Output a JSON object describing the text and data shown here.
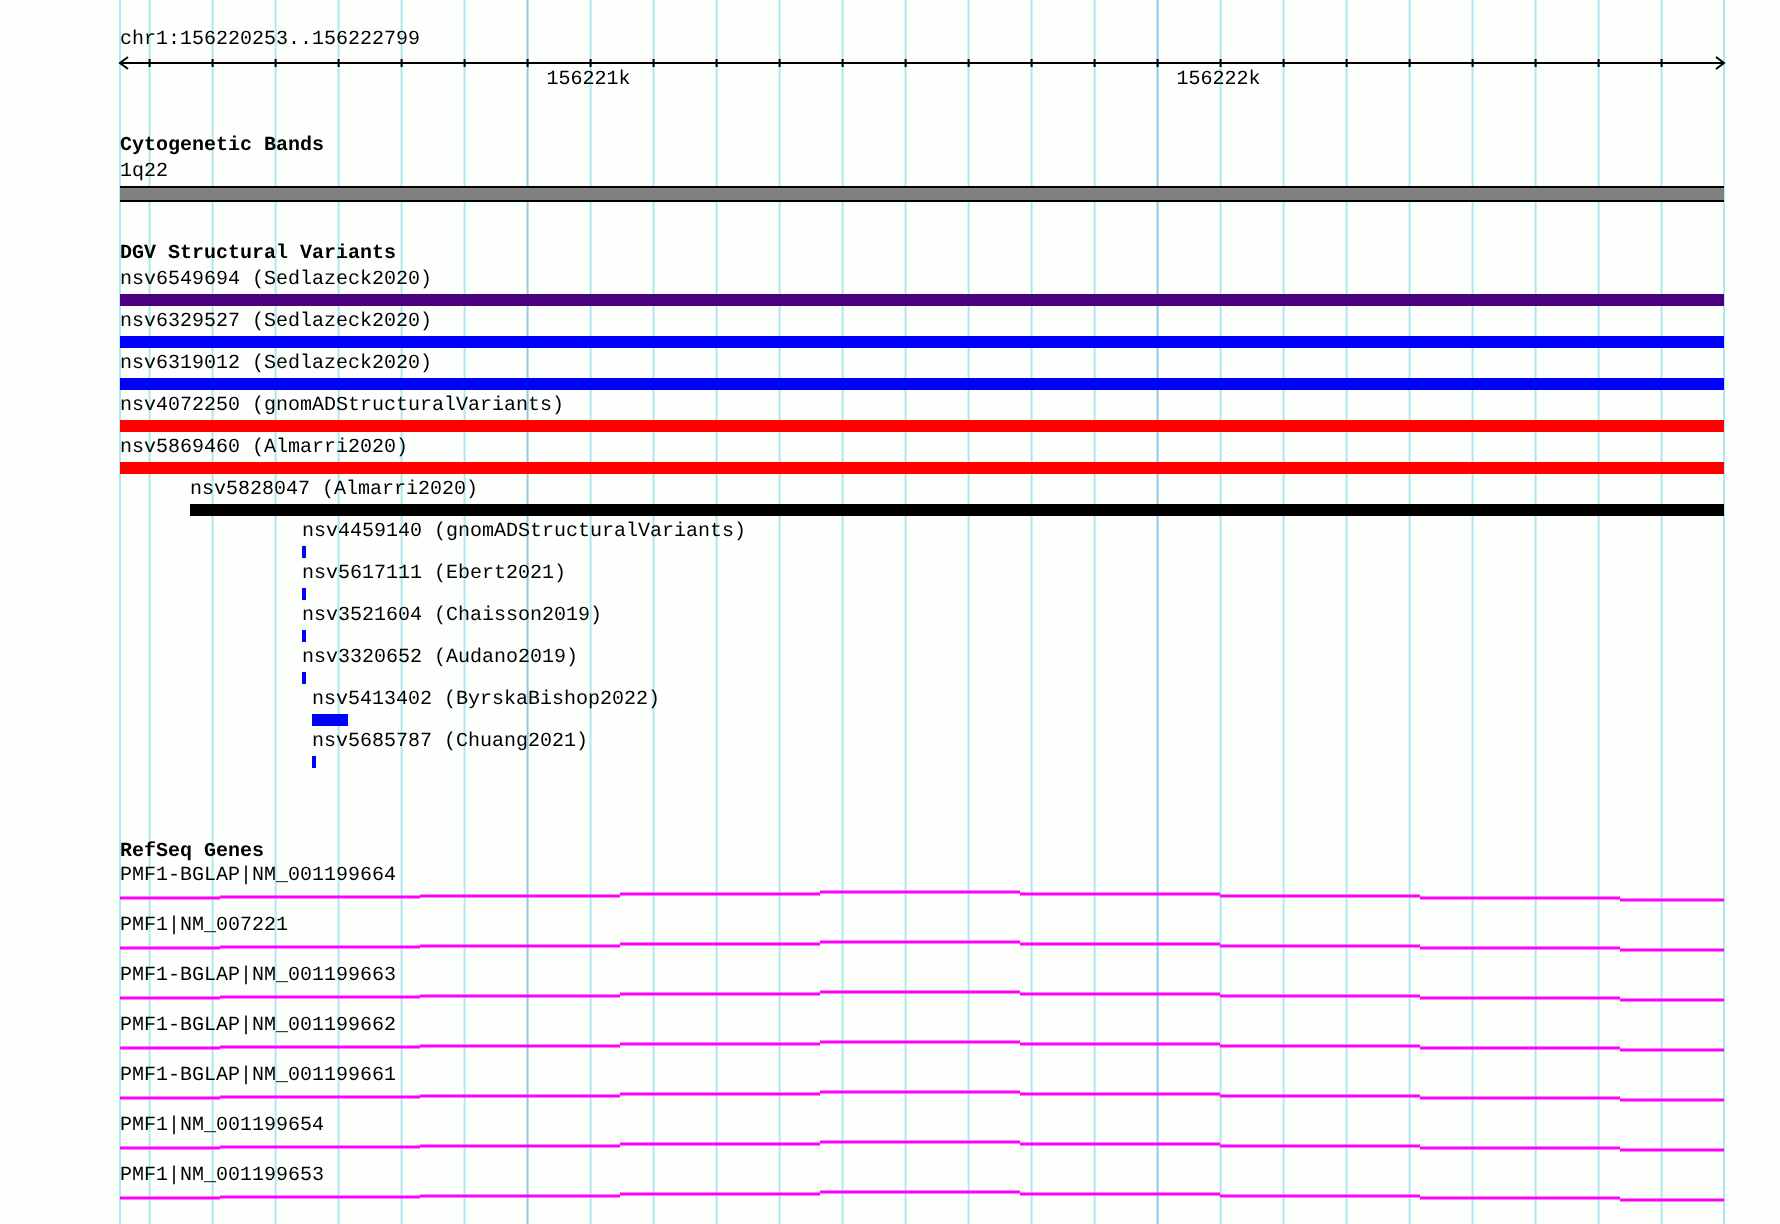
{
  "ruler": {
    "location": "chr1:156220253..156222799",
    "ticks": [
      "156221k",
      "156222k"
    ]
  },
  "tracks": [
    {
      "title": "Cytogenetic Bands",
      "kind": "bands",
      "features": [
        {
          "label": "1q22"
        }
      ]
    },
    {
      "title": "DGV Structural Variants",
      "kind": "variants",
      "features": [
        {
          "label": "nsv6549694 (Sedlazeck2020)",
          "color": "#4b0082"
        },
        {
          "label": "nsv6329527 (Sedlazeck2020)",
          "color": "#0000ff"
        },
        {
          "label": "nsv6319012 (Sedlazeck2020)",
          "color": "#0000ff"
        },
        {
          "label": "nsv4072250 (gnomADStructuralVariants)",
          "color": "#ff0000"
        },
        {
          "label": "nsv5869460 (Almarri2020)",
          "color": "#ff0000"
        },
        {
          "label": "nsv5828047 (Almarri2020)",
          "color": "#000000"
        },
        {
          "label": "nsv4459140 (gnomADStructuralVariants)",
          "color": "#0000ff"
        },
        {
          "label": "nsv5617111 (Ebert2021)",
          "color": "#0000ff"
        },
        {
          "label": "nsv3521604 (Chaisson2019)",
          "color": "#0000ff"
        },
        {
          "label": "nsv3320652 (Audano2019)",
          "color": "#0000ff"
        },
        {
          "label": "nsv5413402 (ByrskaBishop2022)",
          "color": "#0000ff"
        },
        {
          "label": "nsv5685787 (Chuang2021)",
          "color": "#0000ff"
        }
      ]
    },
    {
      "title": "RefSeq Genes",
      "kind": "genes",
      "features": [
        {
          "label": "PMF1-BGLAP|NM_001199664"
        },
        {
          "label": "PMF1|NM_007221"
        },
        {
          "label": "PMF1-BGLAP|NM_001199663"
        },
        {
          "label": "PMF1-BGLAP|NM_001199662"
        },
        {
          "label": "PMF1-BGLAP|NM_001199661"
        },
        {
          "label": "PMF1|NM_001199654"
        },
        {
          "label": "PMF1|NM_001199653"
        }
      ]
    }
  ]
}
